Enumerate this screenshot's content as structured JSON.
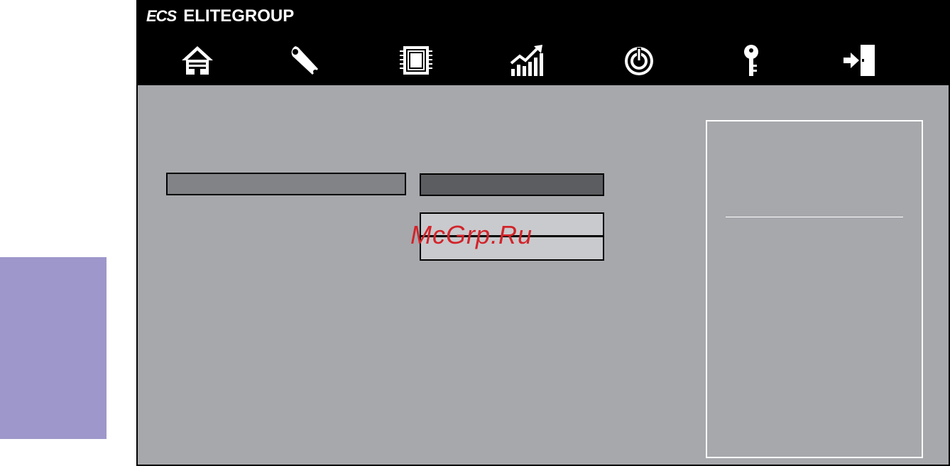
{
  "brand": {
    "mark": "ECS",
    "name": "ELITEGROUP"
  },
  "nav": {
    "items": [
      {
        "id": "main",
        "icon": "home-icon"
      },
      {
        "id": "advanced",
        "icon": "wrench-icon"
      },
      {
        "id": "chipset",
        "icon": "chip-icon"
      },
      {
        "id": "mib",
        "icon": "performance-chart-icon"
      },
      {
        "id": "boot",
        "icon": "power-icon"
      },
      {
        "id": "security",
        "icon": "key-icon"
      },
      {
        "id": "exit",
        "icon": "exit-door-icon"
      }
    ]
  },
  "watermark": "McGrp.Ru",
  "colors": {
    "side_tab": "#9e97cb",
    "content_bg": "#a7a8ac",
    "label_box": "#828387",
    "value_box": "#5c5d60",
    "dropdown": "#c9cacd",
    "watermark": "#d2232a"
  }
}
